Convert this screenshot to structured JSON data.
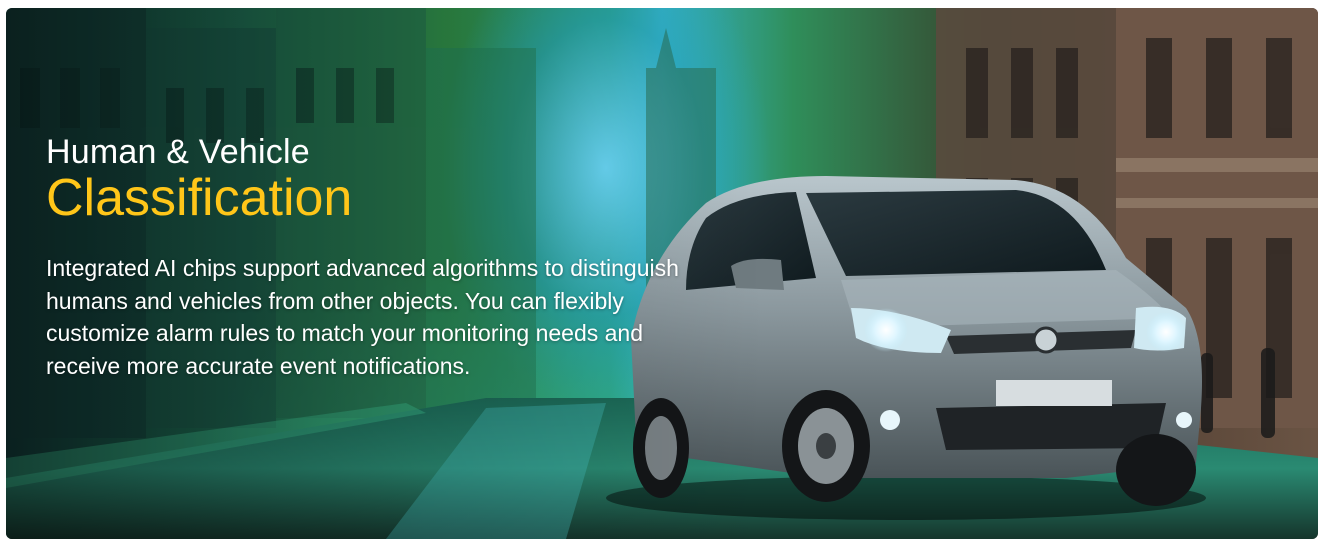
{
  "banner": {
    "heading_line1": "Human & Vehicle",
    "heading_line2": "Classification",
    "description": "Integrated AI chips support advanced algorithms to distinguish humans and vehicles from other objects. You can flexibly customize alarm rules to match your monitoring needs and receive more accurate event notifications."
  },
  "colors": {
    "heading_accent": "#ffc619",
    "text": "#ffffff"
  }
}
